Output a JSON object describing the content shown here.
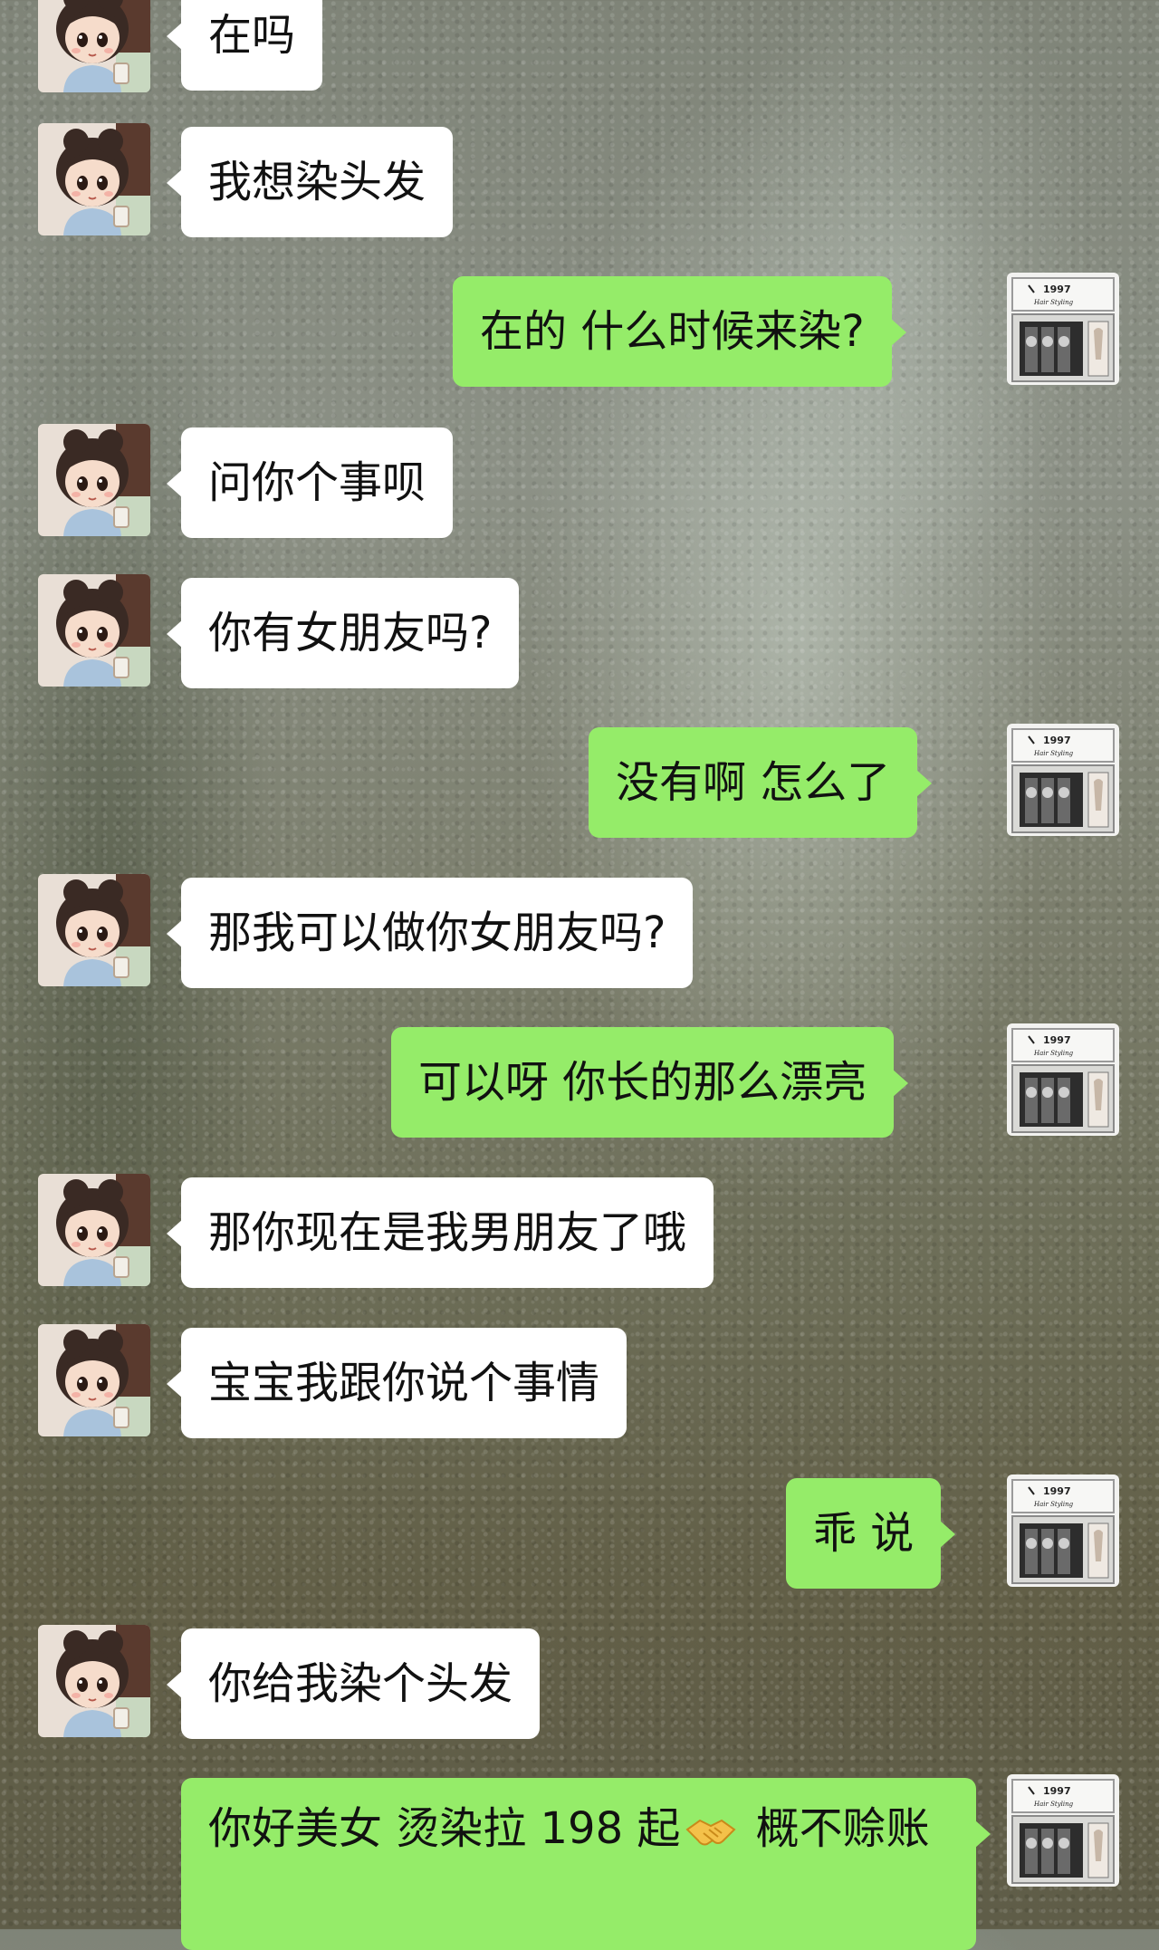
{
  "messages": [
    {
      "side": "in",
      "text": "在吗"
    },
    {
      "side": "in",
      "text": "我想染头发"
    },
    {
      "side": "out",
      "text": "在的  什么时候来染?"
    },
    {
      "side": "in",
      "text": "问你个事呗"
    },
    {
      "side": "in",
      "text": "你有女朋友吗?"
    },
    {
      "side": "out",
      "text": "没有啊  怎么了"
    },
    {
      "side": "in",
      "text": "那我可以做你女朋友吗?"
    },
    {
      "side": "out",
      "text": "可以呀  你长的那么漂亮"
    },
    {
      "side": "in",
      "text": "那你现在是我男朋友了哦"
    },
    {
      "side": "in",
      "text": "宝宝我跟你说个事情"
    },
    {
      "side": "out",
      "text": "乖  说"
    },
    {
      "side": "in",
      "text": "你给我染个头发"
    },
    {
      "side": "out",
      "text_before": "你好美女   烫染拉 198 起",
      "emoji": "handshake",
      "text_after": " 概不赊账"
    }
  ],
  "avatars": {
    "left": {
      "icon": "anime-girl-avatar-icon"
    },
    "right": {
      "icon": "hair-salon-storefront-avatar-icon",
      "sign_number": "1997",
      "sign_text": "Hair Styling"
    }
  },
  "colors": {
    "incoming_bubble": "#ffffff",
    "outgoing_bubble": "#95ec69",
    "text": "#111111"
  }
}
